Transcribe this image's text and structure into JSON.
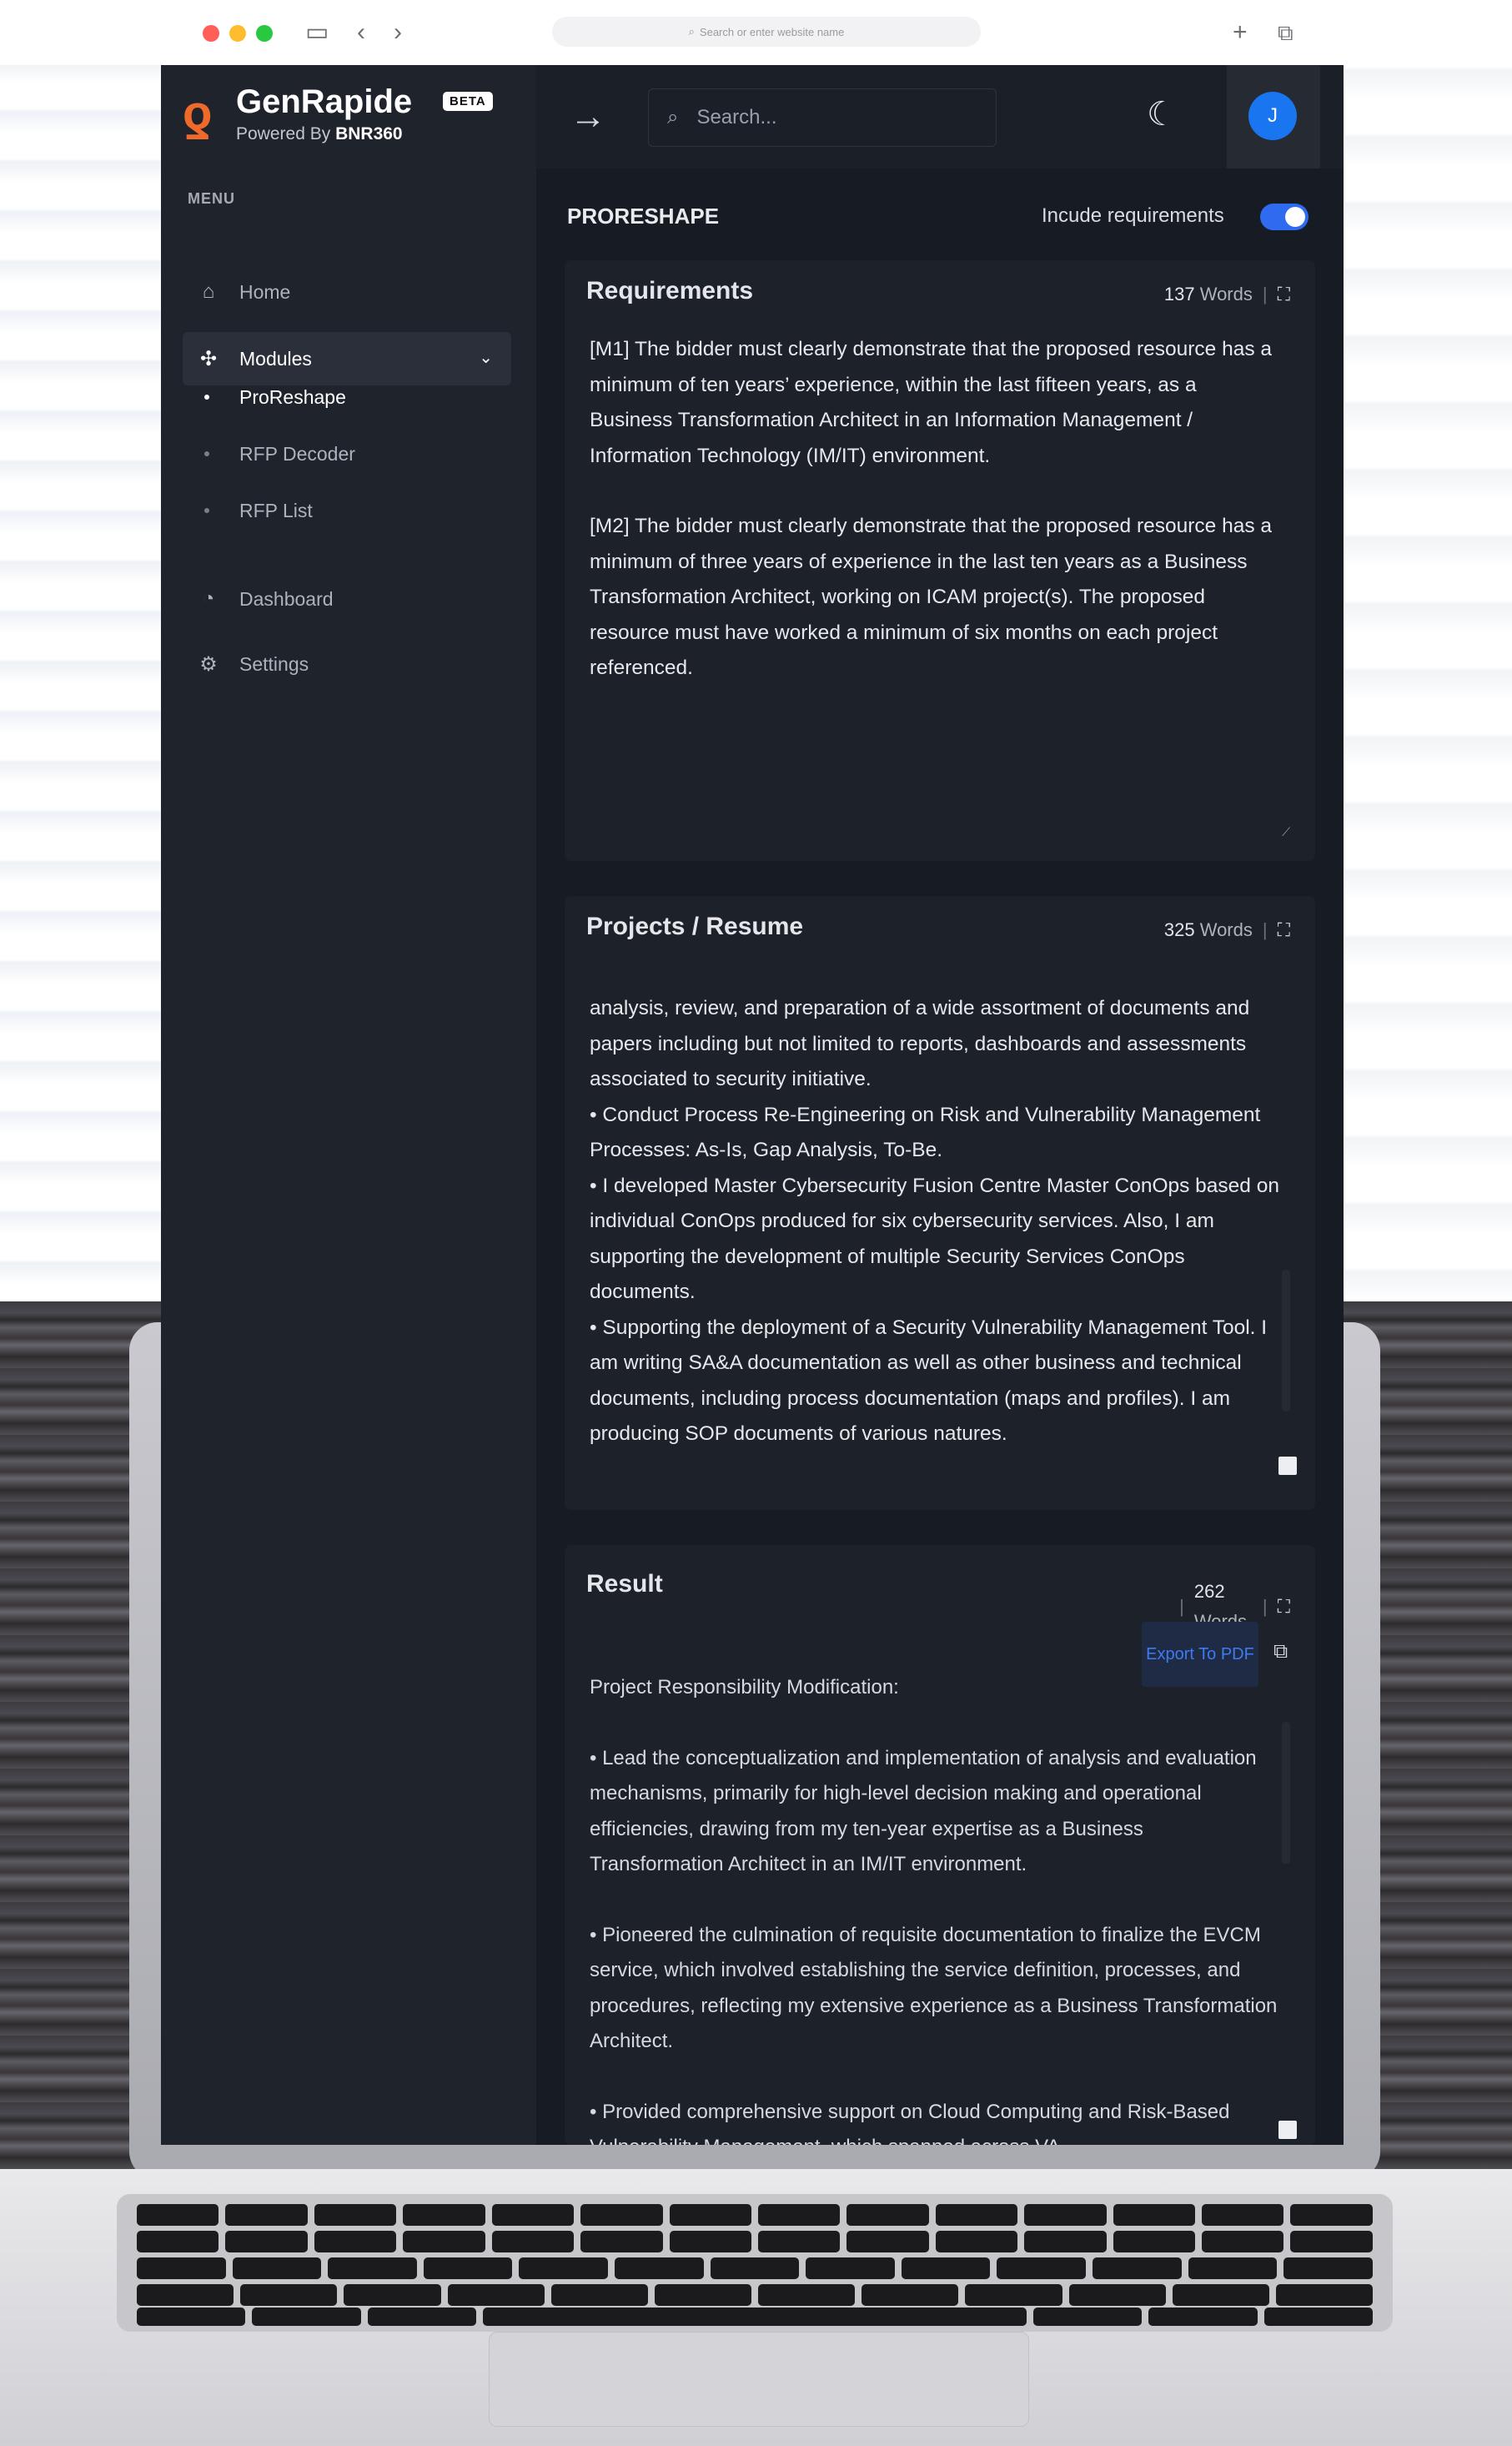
{
  "browser": {
    "url_placeholder": "Search or enter website name"
  },
  "brand": {
    "name": "GenRapide",
    "badge": "BETA",
    "powered_prefix": "Powered By",
    "powered_name": "BNR360"
  },
  "sidebar": {
    "menu_label": "MENU",
    "items": [
      {
        "label": "Home",
        "icon": "home-icon"
      },
      {
        "label": "Modules",
        "icon": "puzzle-icon"
      },
      {
        "label": "Dashboard",
        "icon": "gauge-icon"
      },
      {
        "label": "Settings",
        "icon": "gear-icon"
      }
    ],
    "sub_items": [
      {
        "label": "ProReshape"
      },
      {
        "label": "RFP Decoder"
      },
      {
        "label": "RFP List"
      }
    ]
  },
  "topbar": {
    "search_placeholder": "Search...",
    "avatar_initial": "J"
  },
  "page": {
    "title": "PRORESHAPE",
    "toggle_label": "Incude requirements",
    "toggle_on": true
  },
  "requirements": {
    "title": "Requirements",
    "word_count": "137",
    "words_label": "Words",
    "paragraphs": [
      "[M1] The bidder must clearly demonstrate that the proposed resource has a minimum of ten years’ experience, within the last fifteen years, as a Business Transformation Architect in an Information Management / Information Technology (IM/IT) environment.",
      "[M2] The bidder must clearly demonstrate that the proposed resource has a minimum of three years of experience in the last ten years as a Business Transformation Architect, working on ICAM project(s). The proposed resource must have worked a minimum of six months on each project referenced."
    ]
  },
  "projects": {
    "title": "Projects / Resume",
    "word_count": "325",
    "words_label": "Words",
    "lines": [
      "analysis, review, and preparation of a wide assortment of documents and papers including but not limited to reports, dashboards and assessments associated to security initiative.",
      "•      Conduct Process Re-Engineering on Risk and Vulnerability Management Processes: As-Is, Gap Analysis, To-Be.",
      "•      I developed Master Cybersecurity Fusion Centre Master ConOps based on individual ConOps produced for six cybersecurity services. Also, I am supporting the development of multiple Security Services ConOps documents.",
      "•      Supporting the deployment of a Security Vulnerability Management Tool. I am writing SA&A documentation as well as other business and technical documents, including process documentation (maps and profiles). I am producing SOP documents of various natures."
    ]
  },
  "result": {
    "title": "Result",
    "export_label": "Export To PDF",
    "word_count": "262",
    "words_label": "Words",
    "paragraphs": [
      "Project Responsibility Modification:",
      "• Lead the conceptualization and implementation of analysis and evaluation mechanisms, primarily for high-level decision making and operational efficiencies, drawing from my ten-year expertise as a Business Transformation Architect in an IM/IT environment.",
      "• Pioneered the culmination of requisite documentation to finalize the EVCM service, which involved establishing the service definition, processes, and procedures, reflecting my extensive experience as a Business Transformation Architect.",
      "• Provided comprehensive support on Cloud Computing and Risk-Based Vulnerability Management, which spanned across VA"
    ]
  },
  "colors": {
    "accent": "#2f6bf0",
    "brand_orange": "#ef6a2a",
    "app_bg": "#171b23",
    "panel_bg": "#1d2129"
  }
}
